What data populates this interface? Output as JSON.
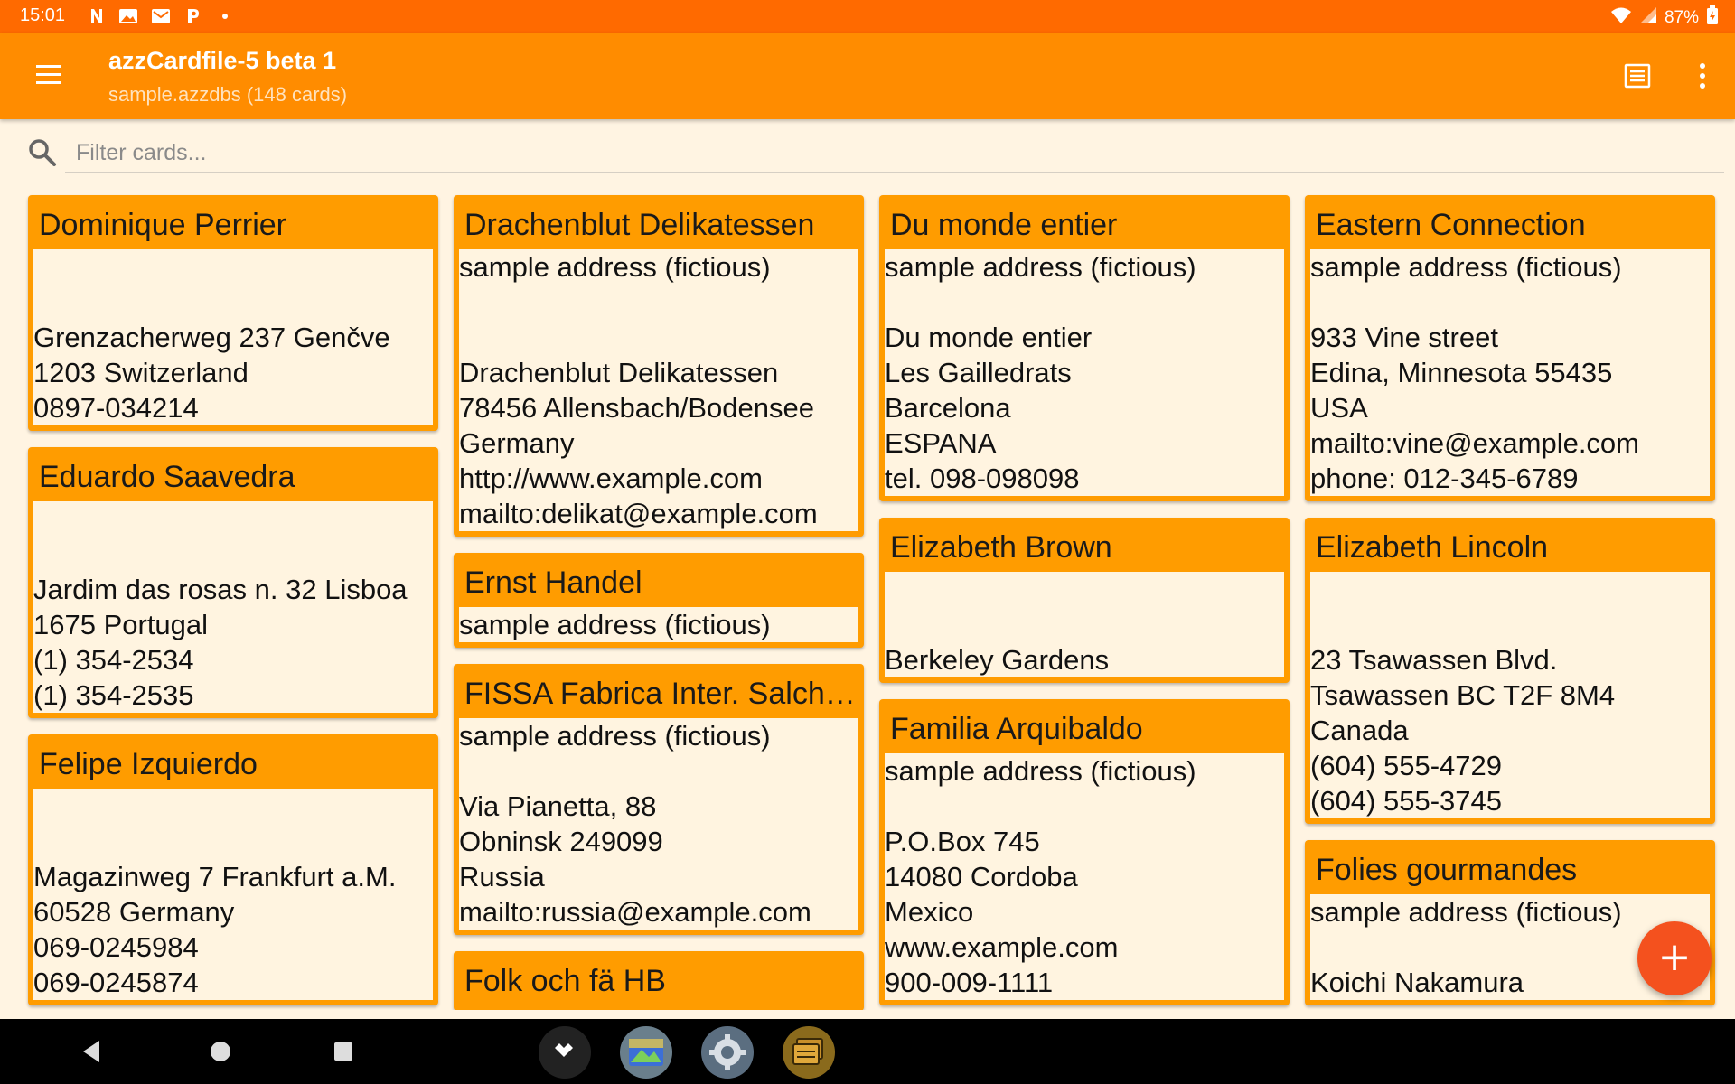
{
  "status_bar": {
    "time": "15:01",
    "battery": "87%",
    "notification_icons": [
      "n-app-icon",
      "picture-icon",
      "mail-icon",
      "p-app-icon",
      "dot-icon"
    ]
  },
  "app_bar": {
    "title": "azzCardfile-5 beta 1",
    "subtitle": "sample.azzdbs (148 cards)"
  },
  "search": {
    "placeholder": "Filter cards..."
  },
  "columns": [
    {
      "cards": [
        {
          "name": "Dominique Perrier",
          "lines": [
            "",
            "",
            "Grenzacherweg 237 Genčve",
            "1203 Switzerland",
            "0897-034214"
          ]
        },
        {
          "name": "Eduardo Saavedra",
          "lines": [
            "",
            "",
            "Jardim das rosas n. 32 Lisboa",
            "1675 Portugal",
            "(1) 354-2534",
            "(1) 354-2535"
          ]
        },
        {
          "name": "Felipe Izquierdo",
          "lines": [
            "",
            "",
            "Magazinweg 7 Frankfurt a.M.",
            "60528 Germany",
            "069-0245984",
            "069-0245874"
          ]
        }
      ]
    },
    {
      "cards": [
        {
          "name": "Drachenblut Delikatessen",
          "lines": [
            "sample  address (fictious)",
            "",
            "",
            "Drachenblut Delikatessen",
            "78456 Allensbach/Bodensee",
            "Germany",
            "http://www.example.com",
            "mailto:delikat@example.com"
          ]
        },
        {
          "name": "Ernst Handel",
          "lines": [
            "sample  address (fictious)"
          ]
        },
        {
          "name": "FISSA Fabrica Inter. Salchichas S.A.",
          "lines": [
            "sample  address (fictious)",
            "",
            "Via Pianetta, 88",
            "Obninsk 249099",
            "Russia",
            "mailto:russia@example.com"
          ]
        },
        {
          "name": "Folk och fä HB",
          "lines": []
        }
      ]
    },
    {
      "cards": [
        {
          "name": "Du monde entier",
          "lines": [
            "sample  address (fictious)",
            "",
            "Du monde entier",
            "Les Gailledrats",
            "Barcelona",
            "ESPANA",
            "tel. 098-098098"
          ]
        },
        {
          "name": "Elizabeth Brown",
          "lines": [
            "",
            "",
            "Berkeley Gardens"
          ]
        },
        {
          "name": "Familia Arquibaldo",
          "lines": [
            "sample  address (fictious)",
            "",
            "P.O.Box 745",
            "14080 Cordoba",
            "Mexico",
            "www.example.com",
            "900-009-1111"
          ]
        }
      ]
    },
    {
      "cards": [
        {
          "name": "Eastern Connection",
          "lines": [
            "sample  address (fictious)",
            "",
            "933 Vine street",
            "Edina, Minnesota 55435",
            "USA",
            "mailto:vine@example.com",
            "phone: 012-345-6789"
          ]
        },
        {
          "name": "Elizabeth Lincoln",
          "lines": [
            "",
            "",
            "23 Tsawassen Blvd.",
            "Tsawassen BC T2F 8M4",
            "Canada",
            "(604) 555-4729",
            "(604) 555-3745"
          ]
        },
        {
          "name": "Folies gourmandes",
          "lines": [
            "sample  address (fictious)",
            "",
            "Koichi Nakamura"
          ]
        }
      ]
    }
  ],
  "fab": {
    "label": "+"
  },
  "colors": {
    "status_bar": "#ff6a00",
    "app_bar": "#ff8c00",
    "card_header": "#ff9c00",
    "card_body": "#fff4e0",
    "fab": "#f4511e"
  }
}
